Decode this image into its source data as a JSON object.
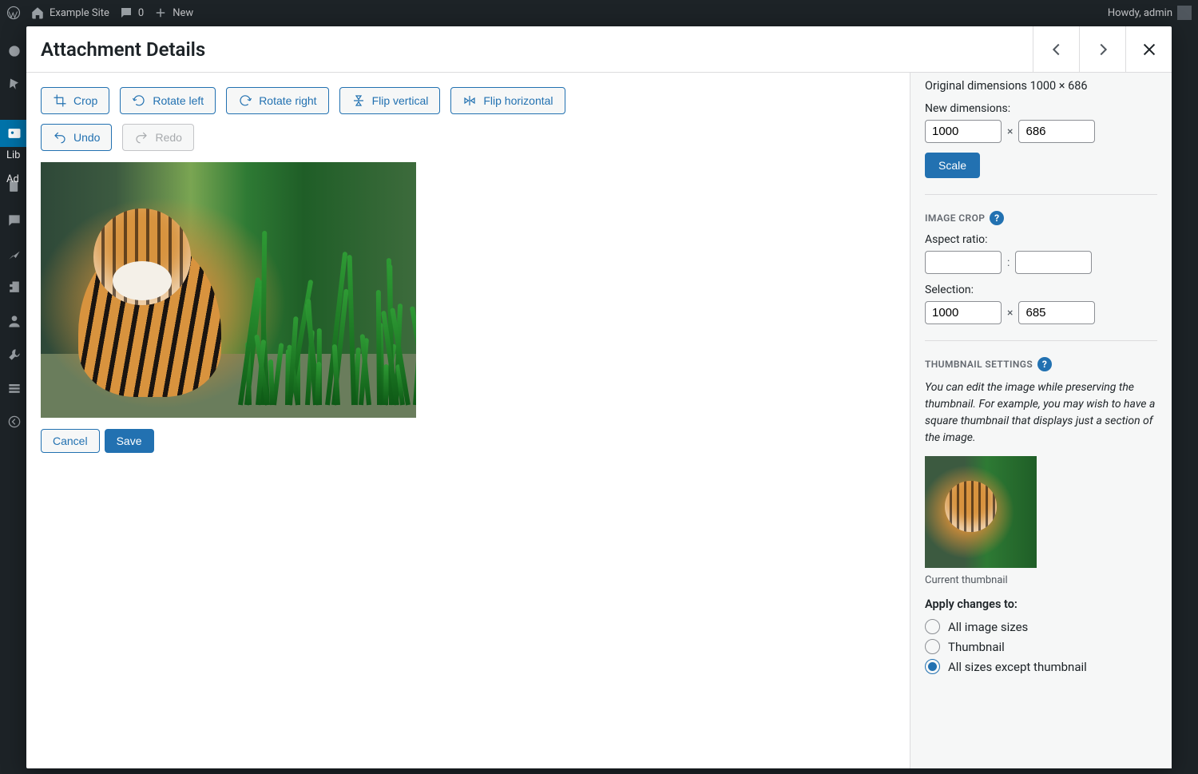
{
  "adminbar": {
    "site_name": "Example Site",
    "comments": "0",
    "new_label": "New",
    "howdy": "Howdy, admin"
  },
  "sidebar_text": {
    "lib": "Lib",
    "ad": "Ad"
  },
  "modal": {
    "title": "Attachment Details",
    "toolbar": {
      "crop": "Crop",
      "rotate_left": "Rotate left",
      "rotate_right": "Rotate right",
      "flip_vertical": "Flip vertical",
      "flip_horizontal": "Flip horizontal",
      "undo": "Undo",
      "redo": "Redo"
    },
    "actions": {
      "cancel": "Cancel",
      "save": "Save"
    }
  },
  "sidepane": {
    "original_dimensions": "Original dimensions 1000 × 686",
    "new_dimensions_label": "New dimensions:",
    "new_w": "1000",
    "new_h": "686",
    "times": "×",
    "colon": ":",
    "scale": "Scale",
    "image_crop_title": "IMAGE CROP",
    "aspect_ratio_label": "Aspect ratio:",
    "ar_w": "",
    "ar_h": "",
    "selection_label": "Selection:",
    "sel_w": "1000",
    "sel_h": "685",
    "thumb_title": "THUMBNAIL SETTINGS",
    "thumb_note": "You can edit the image while preserving the thumbnail. For example, you may wish to have a square thumbnail that displays just a section of the image.",
    "current_thumb": "Current thumbnail",
    "apply_label": "Apply changes to:",
    "opt_all": "All image sizes",
    "opt_thumb": "Thumbnail",
    "opt_except": "All sizes except thumbnail",
    "help_glyph": "?"
  }
}
